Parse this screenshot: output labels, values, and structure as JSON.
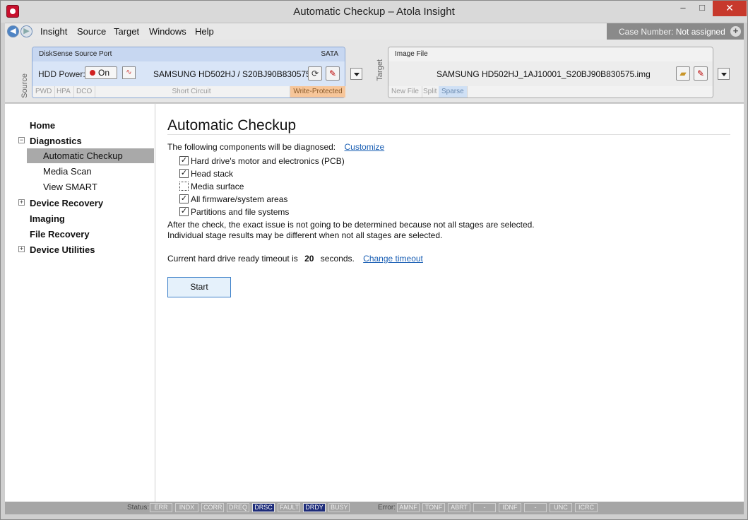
{
  "window": {
    "title": "Automatic Checkup – Atola Insight",
    "minimize": "–",
    "maximize": "□",
    "close": "✕"
  },
  "menubar": {
    "items": [
      {
        "label": "Insight"
      },
      {
        "label": "Source"
      },
      {
        "label": "Target"
      },
      {
        "label": "Windows"
      },
      {
        "label": "Help"
      }
    ],
    "case_label": "Case Number:",
    "case_value": "Not assigned"
  },
  "source": {
    "side_label": "Source",
    "port": "DiskSense Source Port",
    "interface": "SATA",
    "hdd_power_label": "HDD Power:",
    "power_state": "On",
    "drive": "SAMSUNG HD502HJ / S20BJ90B830575",
    "footer": [
      "PWD",
      "HPA",
      "DCO"
    ],
    "short_circuit": "Short Circuit",
    "write_protected": "Write-Protected"
  },
  "target": {
    "side_label": "Target",
    "type": "Image File",
    "file": "SAMSUNG HD502HJ_1AJ10001_S20BJ90B830575.img",
    "footer": [
      "New File",
      "Split",
      "Sparse"
    ]
  },
  "nav": {
    "home": "Home",
    "diagnostics": "Diagnostics",
    "automatic_checkup": "Automatic Checkup",
    "media_scan": "Media Scan",
    "view_smart": "View SMART",
    "device_recovery": "Device Recovery",
    "imaging": "Imaging",
    "file_recovery": "File Recovery",
    "device_utilities": "Device Utilities"
  },
  "main": {
    "title": "Automatic Checkup",
    "intro": "The following components will be diagnosed:",
    "customize": "Customize",
    "components": [
      {
        "label": "Hard drive's motor and electronics (PCB)",
        "checked": true
      },
      {
        "label": "Head stack",
        "checked": true
      },
      {
        "label": "Media surface",
        "checked": false
      },
      {
        "label": "All firmware/system areas",
        "checked": true
      },
      {
        "label": "Partitions and file systems",
        "checked": true
      }
    ],
    "note1": "After the check, the exact issue is not going to be determined because not all stages are selected.",
    "note2": "Individual stage results may be different when not all stages are selected.",
    "timeout_prefix": "Current hard drive ready timeout is",
    "timeout_value": "20",
    "timeout_suffix": "seconds.",
    "change_timeout": "Change timeout",
    "start": "Start"
  },
  "statusbar": {
    "status_label": "Status:",
    "status": [
      {
        "label": "ERR",
        "on": false
      },
      {
        "label": "INDX",
        "on": false
      },
      {
        "label": "CORR",
        "on": false
      },
      {
        "label": "DREQ",
        "on": false
      },
      {
        "label": "DRSC",
        "on": true
      },
      {
        "label": "FAULT",
        "on": false
      },
      {
        "label": "DRDY",
        "on": true
      },
      {
        "label": "BUSY",
        "on": false
      }
    ],
    "error_label": "Error:",
    "error": [
      {
        "label": "AMNF"
      },
      {
        "label": "TONF"
      },
      {
        "label": "ABRT"
      },
      {
        "label": "-"
      },
      {
        "label": "IDNF"
      },
      {
        "label": "-"
      },
      {
        "label": "UNC"
      },
      {
        "label": "ICRC"
      }
    ]
  }
}
